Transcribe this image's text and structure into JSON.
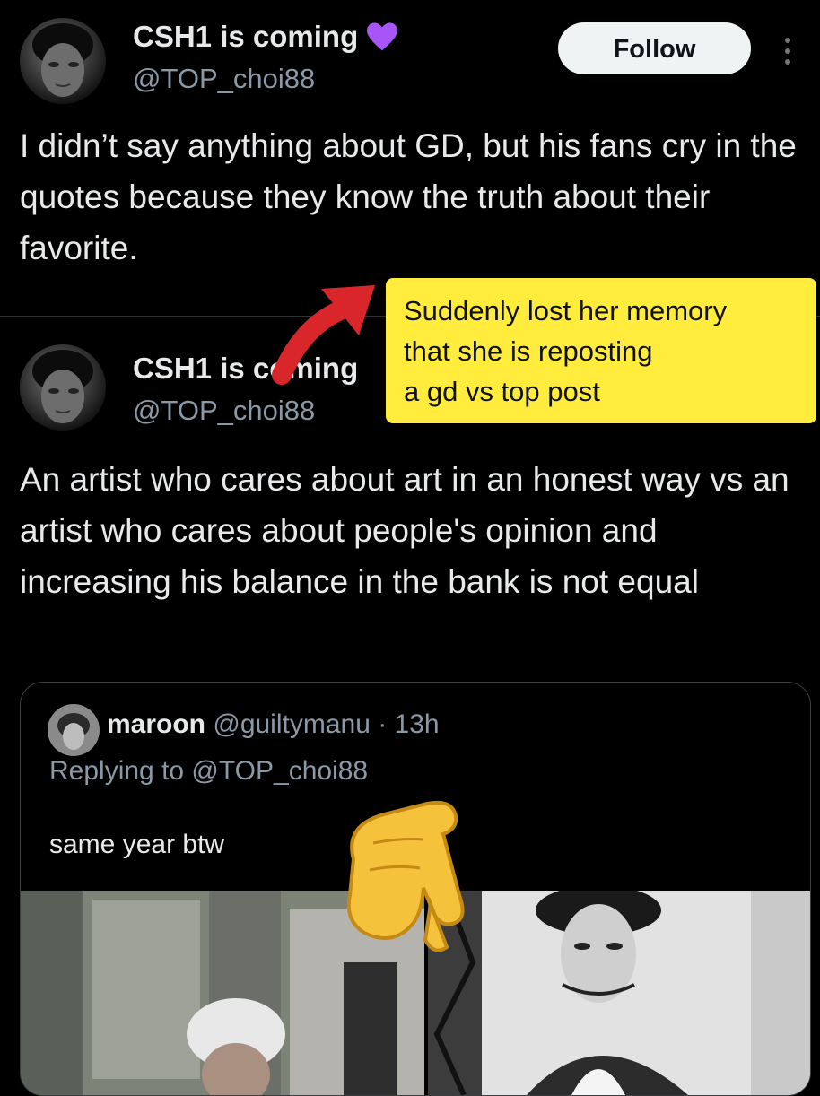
{
  "tweet_main": {
    "display_name": "CSH1 is coming",
    "handle": "@TOP_choi88",
    "follow_label": "Follow",
    "text": "I didn’t say anything about GD, but his fans cry in the quotes because they know the truth about their favorite."
  },
  "tweet_quoted": {
    "display_name": "CSH1 is coming",
    "handle": "@TOP_choi88",
    "text": "An artist who cares about art in an honest way vs an artist who cares about people's opinion and increasing his balance in the bank is not equal"
  },
  "reply_card": {
    "name": "maroon",
    "handle_time": "@guiltymanu · 13h",
    "replying_to": "Replying to @TOP_choi88",
    "text": "same year btw"
  },
  "annotation": {
    "lines": [
      "Suddenly lost her memory",
      "that she is reposting",
      "a gd vs top post"
    ],
    "note_color": "#ffec3d",
    "arrow_color": "#d9262b"
  },
  "icons": {
    "verified": "purple-heart-icon",
    "more": "more-options-icon",
    "pointing": "pointing-hand-emoji"
  }
}
